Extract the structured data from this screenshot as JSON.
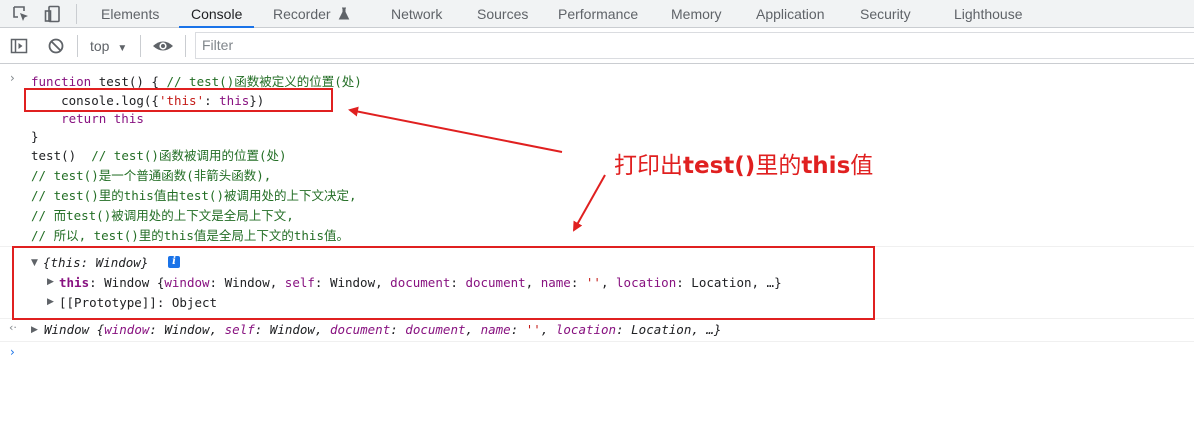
{
  "tabs": [
    "Elements",
    "Console",
    "Recorder",
    "Network",
    "Sources",
    "Performance",
    "Memory",
    "Application",
    "Security",
    "Lighthouse"
  ],
  "active_tab": "Console",
  "toolbar": {
    "context": "top",
    "filter_placeholder": "Filter"
  },
  "code": {
    "l1_kw": "function",
    "l1_fn": " test() { ",
    "l1_cm": "// test()函数被定义的位置(处)",
    "l2_pre": "    console.log({",
    "l2_str": "'this'",
    "l2_colon": ": ",
    "l2_kw": "this",
    "l2_post": "})",
    "l3_kw": "    return this",
    "l4": "}",
    "l5_code": "test()  ",
    "l5_cm": "// test()函数被调用的位置(处)",
    "l6_cm": "// test()是一个普通函数(非箭头函数),",
    "l7_cm": "// test()里的this值由test()被调用处的上下文决定,",
    "l8_cm": "// 而test()被调用处的上下文是全局上下文,",
    "l9_cm": "// 所以, test()里的this值是全局上下文的this值。"
  },
  "output": {
    "obj_summary": "{this: Window}",
    "info_icon": "i",
    "row1_key": "this",
    "row1_sep": ": Window {",
    "row1_k1": "window",
    "row1_v1": ": Window, ",
    "row1_k2": "self",
    "row1_v2": ": Window, ",
    "row1_k3": "document",
    "row1_v3a": ": ",
    "row1_v3b": "document",
    "row1_v3c": ", ",
    "row1_k4": "name",
    "row1_v4a": ": ",
    "row1_v4b": "''",
    "row1_v4c": ", ",
    "row1_k5": "location",
    "row1_v5": ": Location, …}",
    "row2": "[[Prototype]]: Object",
    "ret_a": "Window {",
    "ret_k1": "window",
    "ret_v1": ": Window, ",
    "ret_k2": "self",
    "ret_v2": ": Window, ",
    "ret_k3": "document",
    "ret_v3a": ": ",
    "ret_v3b": "document",
    "ret_v3c": ", ",
    "ret_k4": "name",
    "ret_v4a": ": ",
    "ret_v4b": "''",
    "ret_v4c": ", ",
    "ret_k5": "location",
    "ret_v5": ": Location, …}"
  },
  "annotation": {
    "part1": "打印出",
    "part2": "test()",
    "part3": "里的",
    "part4": "this",
    "part5": "值"
  },
  "colors": {
    "accent": "#1a73e8",
    "annotation": "#e02020",
    "comment": "#236e25",
    "keyword": "#881280"
  }
}
